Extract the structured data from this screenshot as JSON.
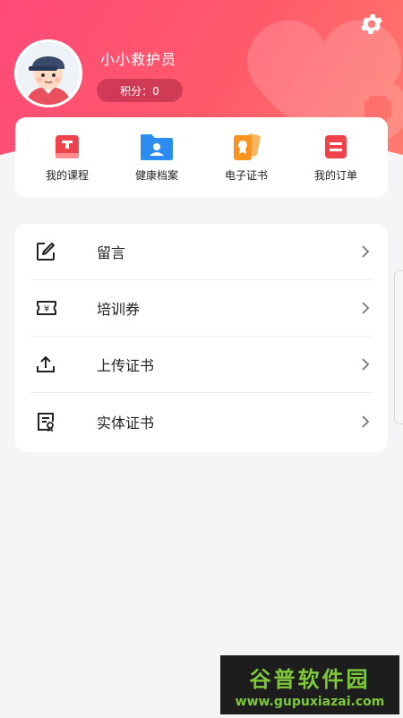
{
  "profile": {
    "name": "小小救护员",
    "points": "积分：0"
  },
  "quick_links": [
    {
      "label": "我的课程",
      "icon": "course-book-icon",
      "color": "#f0424a"
    },
    {
      "label": "健康档案",
      "icon": "health-folder-icon",
      "color": "#2d8cf0"
    },
    {
      "label": "电子证书",
      "icon": "certificate-cards-icon",
      "color": "#f7931e"
    },
    {
      "label": "我的订单",
      "icon": "order-list-icon",
      "color": "#f0424a"
    }
  ],
  "menu": [
    {
      "label": "留言",
      "icon": "edit-icon"
    },
    {
      "label": "培训券",
      "icon": "voucher-icon"
    },
    {
      "label": "上传证书",
      "icon": "upload-icon"
    },
    {
      "label": "实体证书",
      "icon": "certificate-document-icon"
    }
  ],
  "watermark": {
    "title": "谷普软件园",
    "url": "www.gupuxiazai.com"
  },
  "colors": {
    "header_start": "#ff4a78",
    "header_end": "#ff7c6e",
    "background": "#f5f5f7"
  }
}
